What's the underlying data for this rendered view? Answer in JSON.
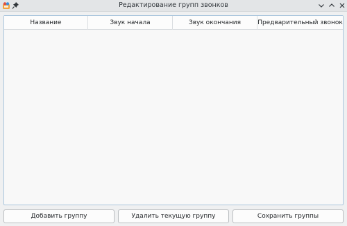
{
  "window": {
    "title": "Редактирование групп звонков"
  },
  "table": {
    "columns": [
      "Название",
      "Звук начала",
      "Звук окончания",
      "Предварительный звонок"
    ],
    "rows": []
  },
  "buttons": {
    "add_label": "Добавить группу",
    "delete_label": "Удалить текущую группу",
    "save_label": "Сохранить группы"
  },
  "colors": {
    "accent": "#a9c5dd",
    "background": "#eff0f1"
  },
  "icons": {
    "app": "app-icon",
    "pin": "pin-icon",
    "minimize": "minimize-icon",
    "maximize": "maximize-icon",
    "close": "close-icon"
  }
}
